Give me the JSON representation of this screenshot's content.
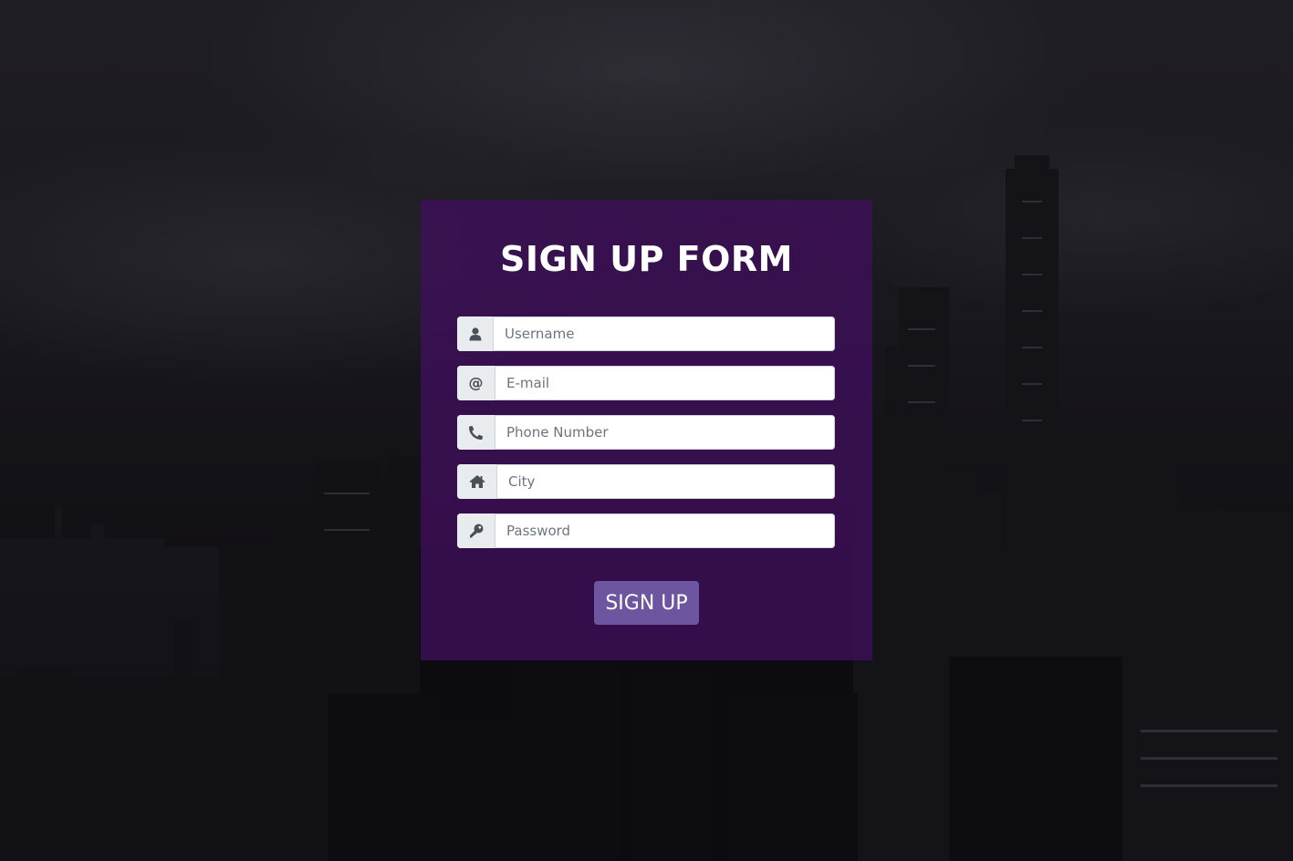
{
  "form": {
    "title": "SIGN UP FORM",
    "fields": [
      {
        "icon": "user-icon",
        "placeholder": "Username",
        "value": ""
      },
      {
        "icon": "at-icon",
        "placeholder": "E-mail",
        "value": ""
      },
      {
        "icon": "phone-icon",
        "placeholder": "Phone Number",
        "value": ""
      },
      {
        "icon": "home-icon",
        "placeholder": "City",
        "value": ""
      },
      {
        "icon": "key-icon",
        "placeholder": "Password",
        "value": ""
      }
    ],
    "at_glyph": "@",
    "submit_label": "SIGN UP"
  },
  "colors": {
    "card_bg": "#400e5c",
    "button_bg": "#6e55a0",
    "addon_bg": "#e9ecef",
    "icon_color": "#495057"
  }
}
